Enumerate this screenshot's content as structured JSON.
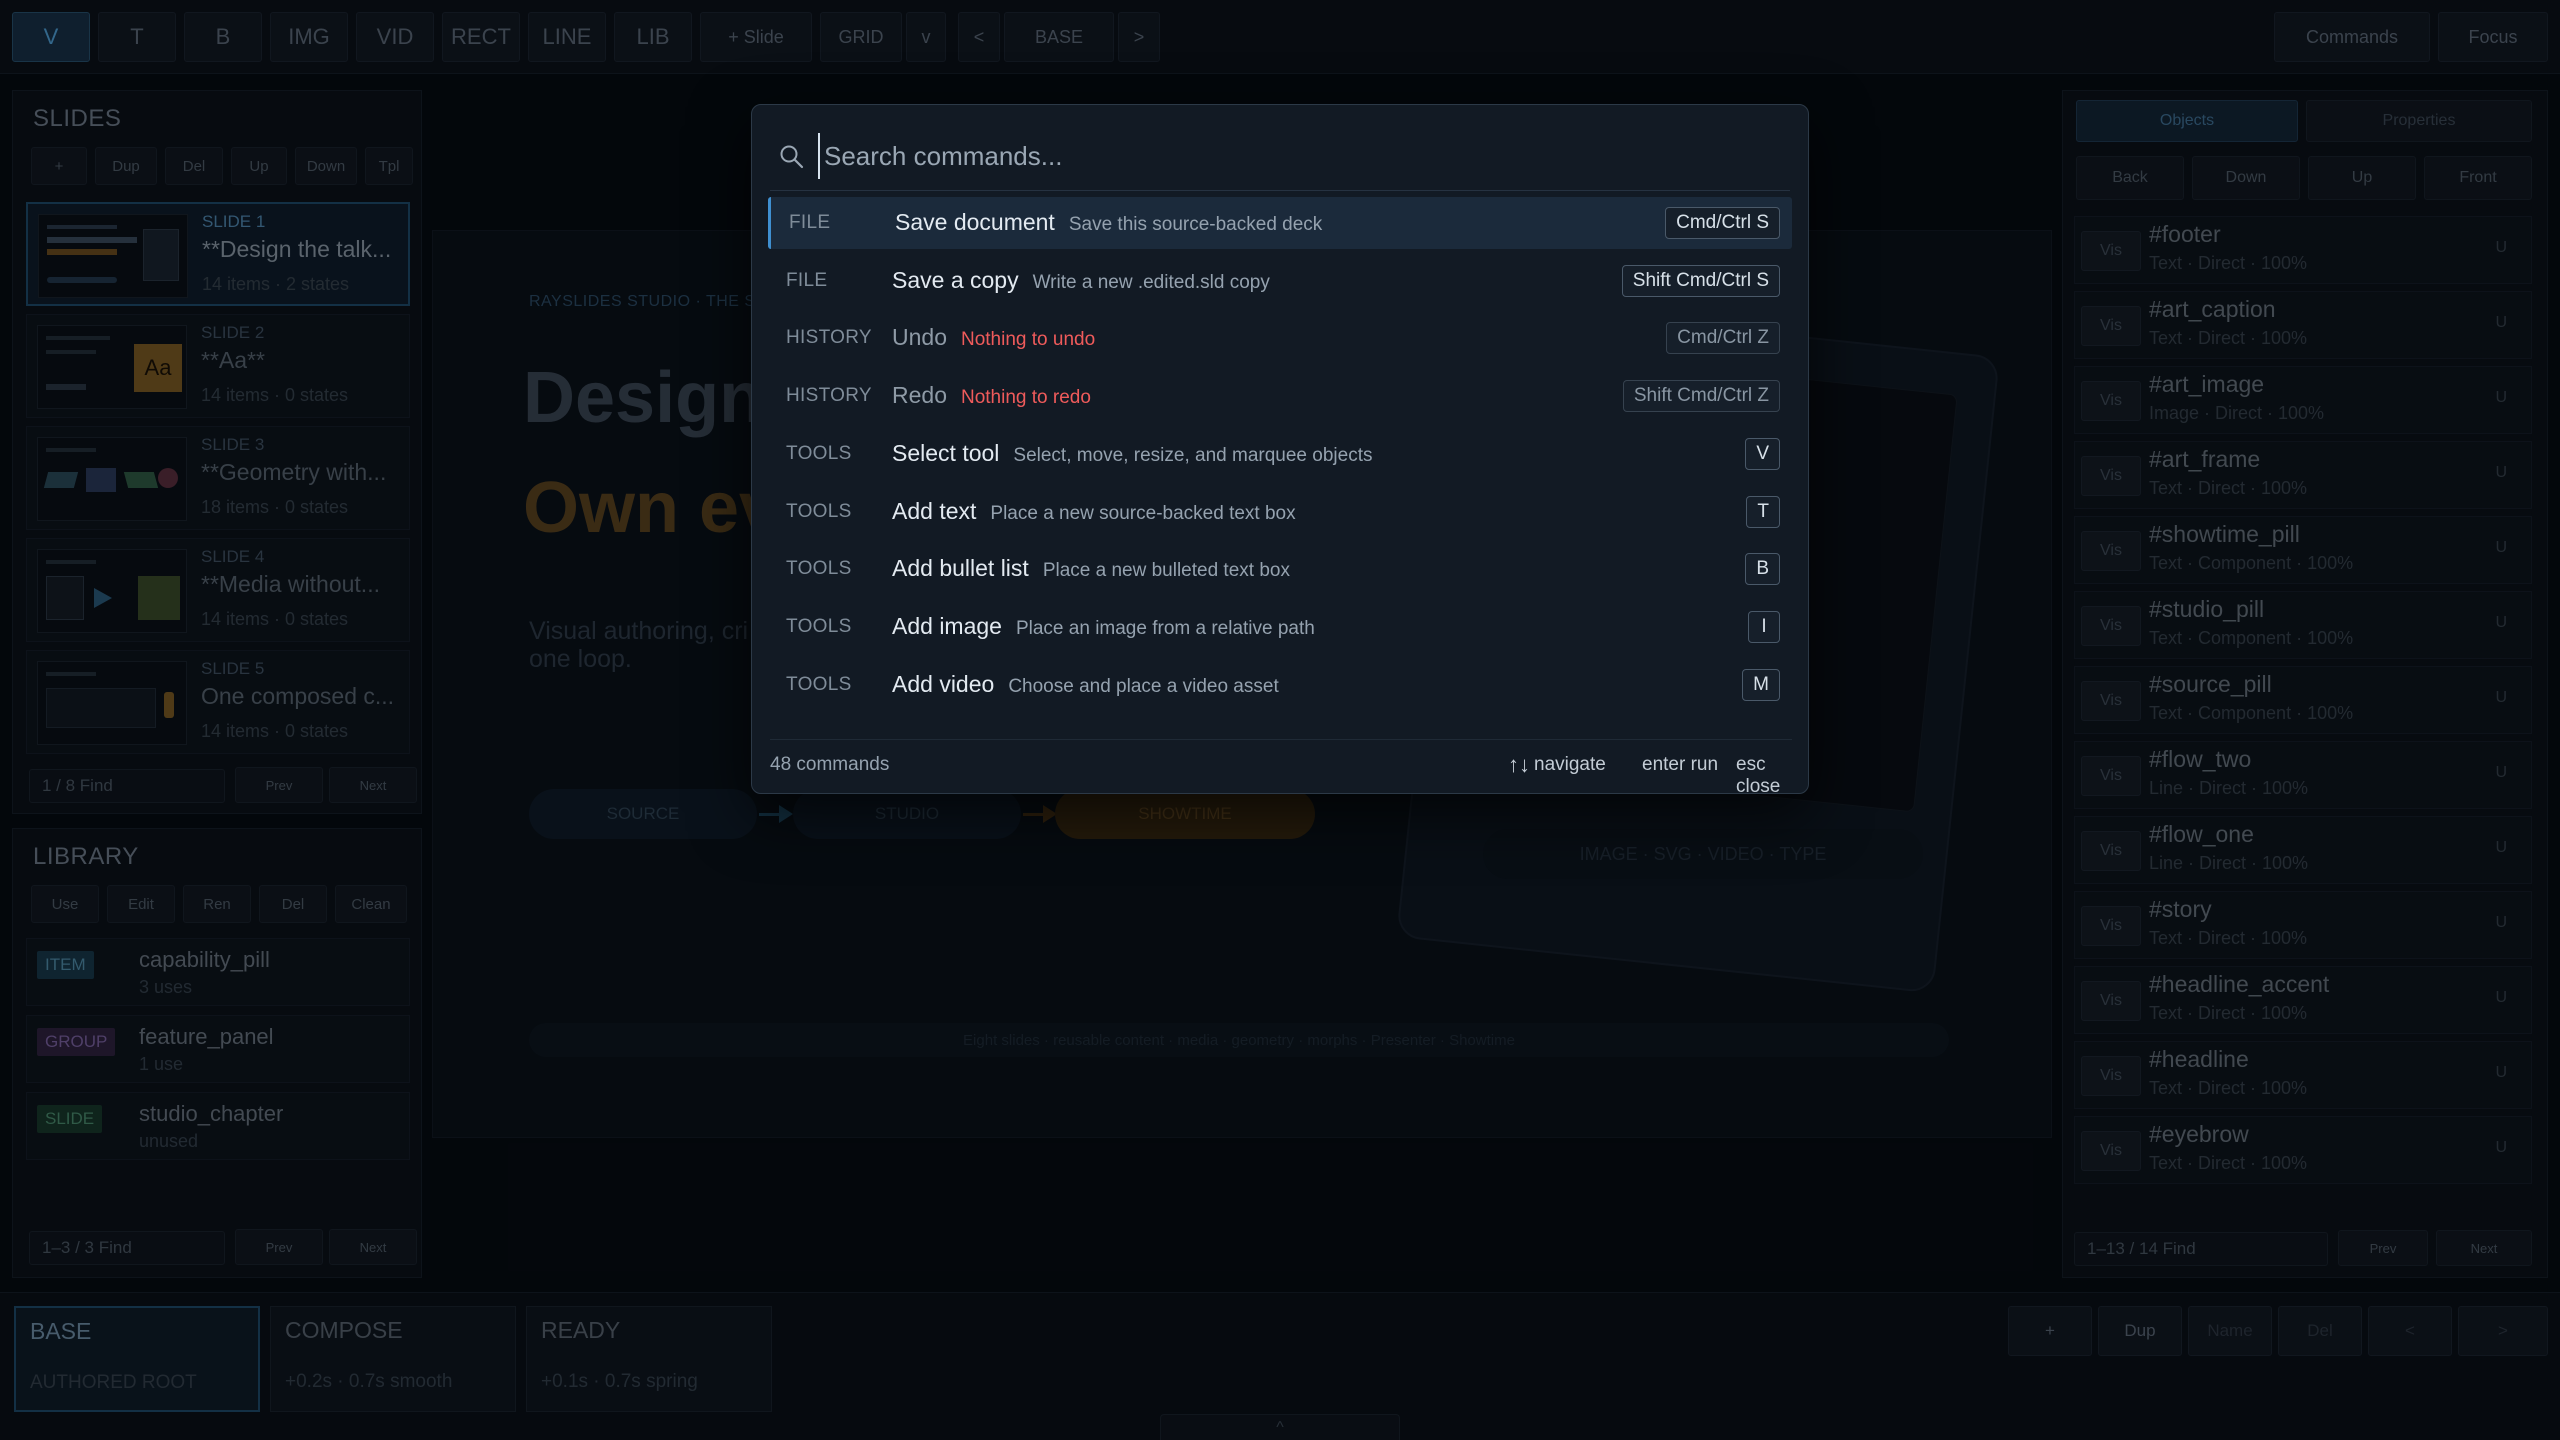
{
  "toolbar": {
    "tools": [
      "V",
      "T",
      "B",
      "IMG",
      "VID",
      "RECT",
      "LINE",
      "LIB"
    ],
    "add_slide": "+ Slide",
    "grid": "GRID",
    "grid_menu": "v",
    "prev": "<",
    "state": "BASE",
    "next": ">",
    "commands": "Commands",
    "focus": "Focus"
  },
  "slides_panel": {
    "title": "SLIDES",
    "actions": [
      "+",
      "Dup",
      "Del",
      "Up",
      "Down",
      "Tpl"
    ],
    "items": [
      {
        "num": "SLIDE 1",
        "name": "**Design the talk...",
        "meta": "14 items · 2 states"
      },
      {
        "num": "SLIDE 2",
        "name": "**Aa**",
        "meta": "14 items · 0 states"
      },
      {
        "num": "SLIDE 3",
        "name": "**Geometry with...",
        "meta": "18 items · 0 states"
      },
      {
        "num": "SLIDE 4",
        "name": "**Media without...",
        "meta": "14 items · 0 states"
      },
      {
        "num": "SLIDE 5",
        "name": "One composed c...",
        "meta": "14 items · 0 states"
      }
    ],
    "thumb_aa": "Aa",
    "find": "1 / 8  Find",
    "prev": "Prev",
    "next": "Next"
  },
  "library_panel": {
    "title": "LIBRARY",
    "actions": [
      "Use",
      "Edit",
      "Ren",
      "Del",
      "Clean"
    ],
    "items": [
      {
        "badge": "ITEM",
        "name": "capability_pill",
        "meta": "3 uses",
        "color": "#2f6e8e"
      },
      {
        "badge": "GROUP",
        "name": "feature_panel",
        "meta": "1 use",
        "color": "#6a4a8e"
      },
      {
        "badge": "SLIDE",
        "name": "studio_chapter",
        "meta": "unused",
        "color": "#2f7a5e"
      }
    ],
    "find": "1–3 / 3  Find",
    "prev": "Prev",
    "next": "Next"
  },
  "canvas": {
    "eyebrow": "RAYSLIDES STUDIO · THE SOURC",
    "headline": "Design",
    "headline_accent": "Own ev",
    "story": "Visual authoring, cri",
    "story_line2": "one loop.",
    "flow": [
      "SOURCE",
      "STUDIO",
      "SHOWTIME"
    ],
    "art_caption": "IMAGE · SVG · VIDEO · TYPE",
    "footer": "Eight slides · reusable content · media · geometry · morphs · Presenter · Showtime"
  },
  "objects_panel": {
    "tabs": [
      "Objects",
      "Properties"
    ],
    "order": [
      "Back",
      "Down",
      "Up",
      "Front"
    ],
    "vis": "Vis",
    "lock": "U",
    "items": [
      {
        "name": "#footer",
        "meta": "Text · Direct · 100%"
      },
      {
        "name": "#art_caption",
        "meta": "Text · Direct · 100%"
      },
      {
        "name": "#art_image",
        "meta": "Image · Direct · 100%"
      },
      {
        "name": "#art_frame",
        "meta": "Text · Direct · 100%"
      },
      {
        "name": "#showtime_pill",
        "meta": "Text · Component · 100%"
      },
      {
        "name": "#studio_pill",
        "meta": "Text · Component · 100%"
      },
      {
        "name": "#source_pill",
        "meta": "Text · Component · 100%"
      },
      {
        "name": "#flow_two",
        "meta": "Line · Direct · 100%"
      },
      {
        "name": "#flow_one",
        "meta": "Line · Direct · 100%"
      },
      {
        "name": "#story",
        "meta": "Text · Direct · 100%"
      },
      {
        "name": "#headline_accent",
        "meta": "Text · Direct · 100%"
      },
      {
        "name": "#headline",
        "meta": "Text · Direct · 100%"
      },
      {
        "name": "#eyebrow",
        "meta": "Text · Direct · 100%"
      }
    ],
    "find": "1–13 / 14  Find",
    "prev": "Prev",
    "next": "Next"
  },
  "timeline": {
    "states": [
      {
        "name": "BASE",
        "meta": "AUTHORED ROOT"
      },
      {
        "name": "COMPOSE",
        "meta": "+0.2s · 0.7s smooth"
      },
      {
        "name": "READY",
        "meta": "+0.1s · 0.7s spring"
      }
    ],
    "actions": [
      "+",
      "Dup",
      "Name",
      "Del",
      "<",
      ">"
    ],
    "collapse": "^"
  },
  "palette": {
    "placeholder": "Search commands...",
    "value": "",
    "commands": [
      {
        "category": "FILE",
        "title": "Save document",
        "desc": "Save this source-backed deck",
        "shortcut": "Cmd/Ctrl S",
        "warn": false,
        "enabled": true
      },
      {
        "category": "FILE",
        "title": "Save a copy",
        "desc": "Write a new .edited.sld copy",
        "shortcut": "Shift Cmd/Ctrl S",
        "warn": false,
        "enabled": true
      },
      {
        "category": "HISTORY",
        "title": "Undo",
        "desc": "Nothing to undo",
        "shortcut": "Cmd/Ctrl Z",
        "warn": true,
        "enabled": false
      },
      {
        "category": "HISTORY",
        "title": "Redo",
        "desc": "Nothing to redo",
        "shortcut": "Shift Cmd/Ctrl Z",
        "warn": true,
        "enabled": false
      },
      {
        "category": "TOOLS",
        "title": "Select tool",
        "desc": "Select, move, resize, and marquee objects",
        "shortcut": "V",
        "warn": false,
        "enabled": true
      },
      {
        "category": "TOOLS",
        "title": "Add text",
        "desc": "Place a new source-backed text box",
        "shortcut": "T",
        "warn": false,
        "enabled": true
      },
      {
        "category": "TOOLS",
        "title": "Add bullet list",
        "desc": "Place a new bulleted text box",
        "shortcut": "B",
        "warn": false,
        "enabled": true
      },
      {
        "category": "TOOLS",
        "title": "Add image",
        "desc": "Place an image from a relative path",
        "shortcut": "I",
        "warn": false,
        "enabled": true
      },
      {
        "category": "TOOLS",
        "title": "Add video",
        "desc": "Choose and place a video asset",
        "shortcut": "M",
        "warn": false,
        "enabled": true
      }
    ],
    "count": "48 commands",
    "hint_navigate": "navigate",
    "hint_run": "enter run",
    "hint_close": "esc close"
  },
  "colors": {
    "accent": "#3f8fd0",
    "warning": "#ef5b5b",
    "headline_accent": "#e8a03a"
  }
}
